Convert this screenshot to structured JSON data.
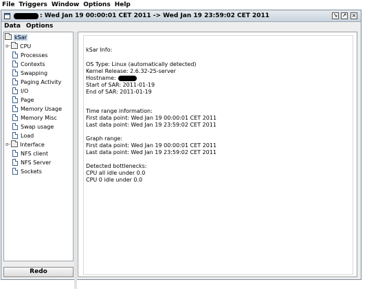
{
  "menubar": {
    "items": [
      "File",
      "Triggers",
      "Window",
      "Options",
      "Help"
    ]
  },
  "window": {
    "title": " : Wed Jan 19 00:00:01 CET 2011 -> Wed Jan 19 23:59:02 CET 2011",
    "menu": [
      "Data",
      "Options"
    ]
  },
  "tree": {
    "root": "kSar",
    "nodes": [
      {
        "label": "CPU",
        "type": "folder",
        "toggle": "o-"
      },
      {
        "label": "Processes",
        "type": "doc"
      },
      {
        "label": "Contexts",
        "type": "doc"
      },
      {
        "label": "Swapping",
        "type": "doc"
      },
      {
        "label": "Paging Activity",
        "type": "doc"
      },
      {
        "label": "I/O",
        "type": "doc"
      },
      {
        "label": "Page",
        "type": "doc"
      },
      {
        "label": "Memory Usage",
        "type": "doc"
      },
      {
        "label": "Memory Misc",
        "type": "doc"
      },
      {
        "label": "Swap usage",
        "type": "doc"
      },
      {
        "label": "Load",
        "type": "doc"
      },
      {
        "label": "Interface",
        "type": "folder",
        "toggle": "o-"
      },
      {
        "label": "NFS client",
        "type": "doc"
      },
      {
        "label": "NFS Server",
        "type": "doc"
      },
      {
        "label": "Sockets",
        "type": "doc"
      }
    ]
  },
  "redo_label": "Redo",
  "info": {
    "heading": "kSar Info:",
    "os_type": "OS Type: Linux (automatically detected)",
    "kernel": "Kernel Release: 2.6.32-25-server",
    "hostname": "Hostname:",
    "start": "Start of SAR: 2011-01-19",
    "end": "End of SAR: 2011-01-19",
    "time_range_heading": "Time range information:",
    "tr_first": "First data point: Wed Jan 19 00:00:01 CET 2011",
    "tr_last": "Last data point: Wed Jan 19 23:59:02 CET 2011",
    "graph_range_heading": "Graph range:",
    "gr_first": "First data point: Wed Jan 19 00:00:01 CET 2011",
    "gr_last": "Last data point: Wed Jan 19 23:59:02 CET 2011",
    "bottlenecks_heading": " Detected bottlenecks:",
    "bottleneck_1": " CPU all idle under 0.0",
    "bottleneck_2": " CPU 0 idle under 0.0"
  }
}
